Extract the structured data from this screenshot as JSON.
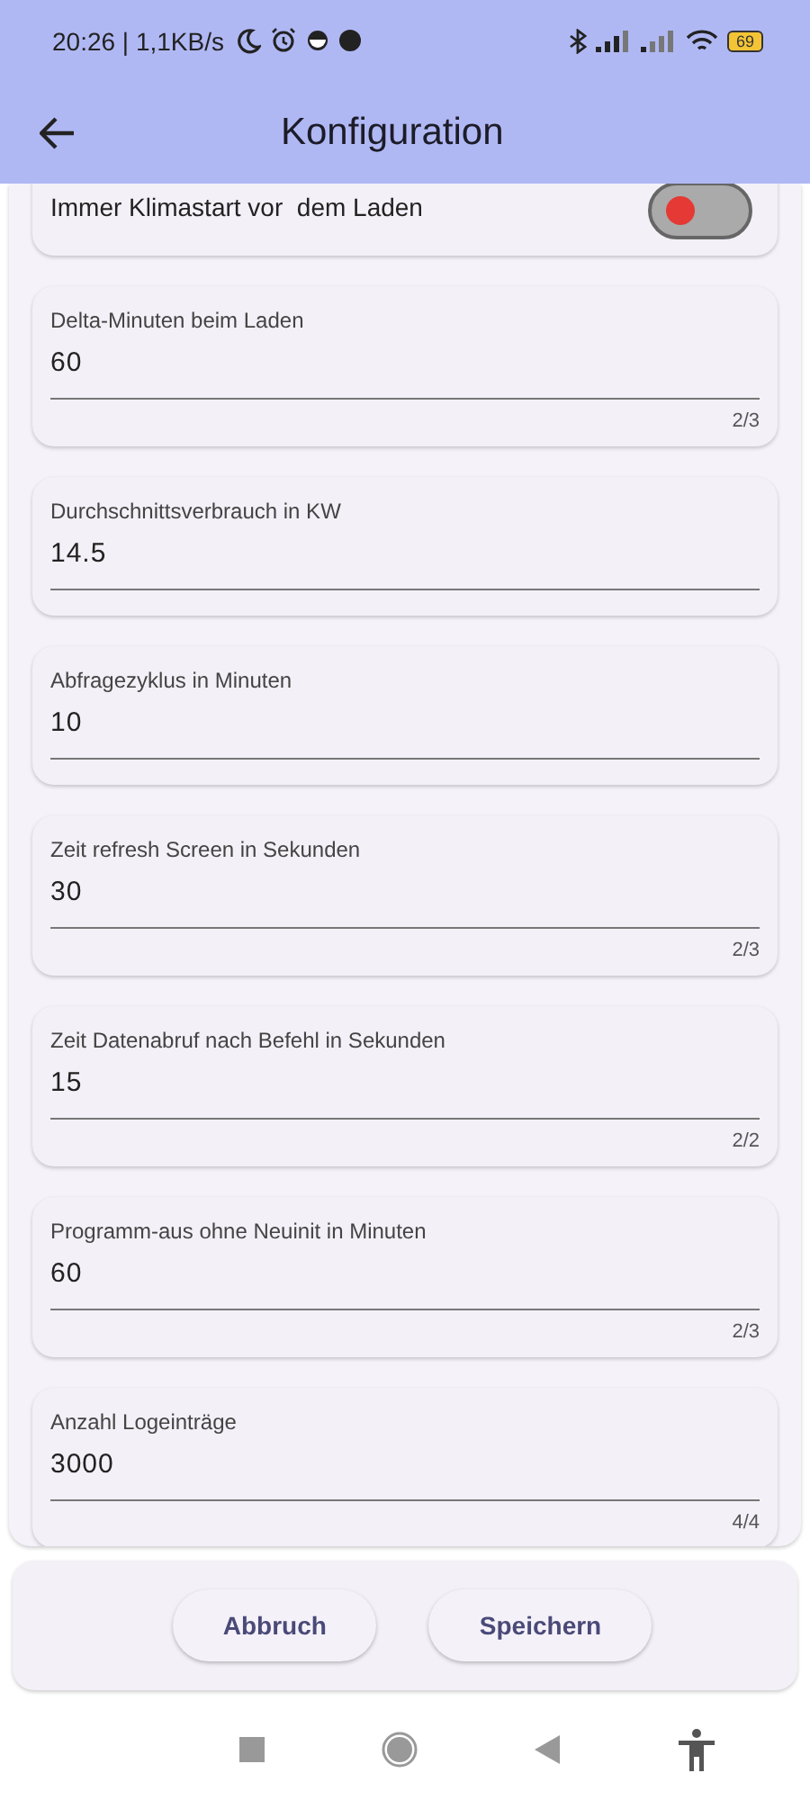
{
  "status_bar": {
    "time": "20:26 | 1,1KB/s",
    "battery": "69"
  },
  "app_bar": {
    "title": "Konfiguration"
  },
  "toggle": {
    "label": "Immer Klimastart vor  dem Laden",
    "on": false
  },
  "fields": [
    {
      "label": "Delta-Minuten beim Laden",
      "value": "60",
      "counter": "2/3"
    },
    {
      "label": "Durchschnittsverbrauch in KW",
      "value": "14.5"
    },
    {
      "label": "Abfragezyklus in Minuten",
      "value": "10"
    },
    {
      "label": "Zeit refresh Screen in Sekunden",
      "value": "30",
      "counter": "2/3"
    },
    {
      "label": "Zeit Datenabruf nach Befehl in Sekunden",
      "value": "15",
      "counter": "2/2"
    },
    {
      "label": "Programm-aus ohne Neuinit in Minuten",
      "value": "60",
      "counter": "2/3"
    },
    {
      "label": "Anzahl Logeinträge",
      "value": "3000",
      "counter": "4/4"
    }
  ],
  "buttons": [
    "Abbruch",
    "Speichern"
  ]
}
